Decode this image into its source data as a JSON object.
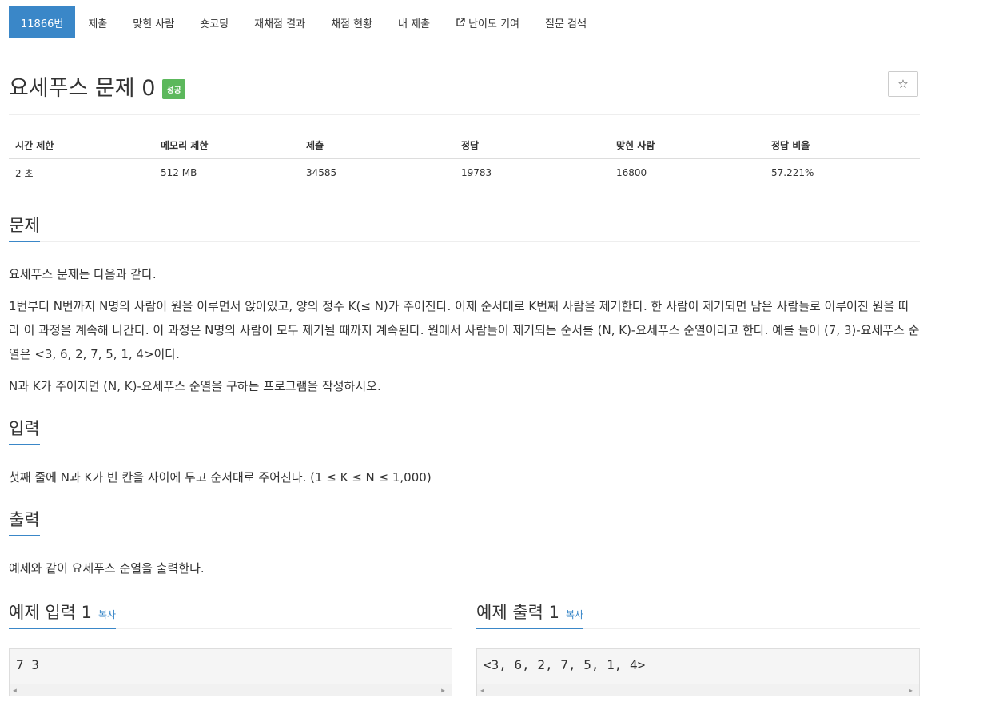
{
  "nav": {
    "items": [
      {
        "label": "11866번",
        "active": true
      },
      {
        "label": "제출"
      },
      {
        "label": "맞힌 사람"
      },
      {
        "label": "숏코딩"
      },
      {
        "label": "재채점 결과"
      },
      {
        "label": "채점 현황"
      },
      {
        "label": "내 제출"
      },
      {
        "label": "난이도 기여",
        "icon": "external-link-icon"
      },
      {
        "label": "질문 검색"
      }
    ]
  },
  "problem": {
    "title": "요세푸스 문제 0",
    "badge": "성공",
    "star": "☆"
  },
  "info": {
    "headers": [
      "시간 제한",
      "메모리 제한",
      "제출",
      "정답",
      "맞힌 사람",
      "정답 비율"
    ],
    "values": [
      "2 초",
      "512 MB",
      "34585",
      "19783",
      "16800",
      "57.221%"
    ]
  },
  "sections": {
    "problem_heading": "문제",
    "problem_p1": "요세푸스 문제는 다음과 같다.",
    "problem_p2": "1번부터 N번까지 N명의 사람이 원을 이루면서 앉아있고, 양의 정수 K(≤ N)가 주어진다. 이제 순서대로 K번째 사람을 제거한다. 한 사람이 제거되면 남은 사람들로 이루어진 원을 따라 이 과정을 계속해 나간다. 이 과정은 N명의 사람이 모두 제거될 때까지 계속된다. 원에서 사람들이 제거되는 순서를 (N, K)-요세푸스 순열이라고 한다. 예를 들어 (7, 3)-요세푸스 순열은 <3, 6, 2, 7, 5, 1, 4>이다.",
    "problem_p3": "N과 K가 주어지면 (N, K)-요세푸스 순열을 구하는 프로그램을 작성하시오.",
    "input_heading": "입력",
    "input_p": "첫째 줄에 N과 K가 빈 칸을 사이에 두고 순서대로 주어진다. (1 ≤ K ≤ N ≤ 1,000)",
    "output_heading": "출력",
    "output_p": "예제와 같이 요세푸스 순열을 출력한다."
  },
  "samples": {
    "input_heading": "예제 입력 1",
    "output_heading": "예제 출력 1",
    "copy_label": "복사",
    "input_value": "7 3",
    "output_value": "<3, 6, 2, 7, 5, 1, 4>"
  }
}
